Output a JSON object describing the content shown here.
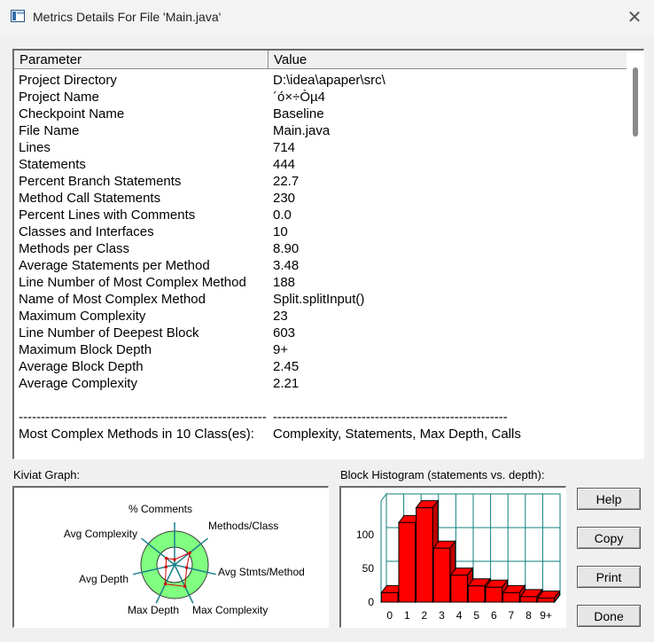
{
  "window": {
    "title": "Metrics Details For File 'Main.java'"
  },
  "table": {
    "headers": {
      "parameter": "Parameter",
      "value": "Value"
    },
    "rows": [
      {
        "p": "Project Directory",
        "v": "D:\\idea\\apaper\\src\\"
      },
      {
        "p": "Project Name",
        "v": "´ó×÷Òµ4"
      },
      {
        "p": "Checkpoint Name",
        "v": "Baseline"
      },
      {
        "p": "File Name",
        "v": "Main.java"
      },
      {
        "p": "Lines",
        "v": "714"
      },
      {
        "p": "Statements",
        "v": "444"
      },
      {
        "p": "Percent Branch Statements",
        "v": "22.7"
      },
      {
        "p": "Method Call Statements",
        "v": "230"
      },
      {
        "p": "Percent Lines with Comments",
        "v": "0.0"
      },
      {
        "p": "Classes and Interfaces",
        "v": "10"
      },
      {
        "p": "Methods per Class",
        "v": "8.90"
      },
      {
        "p": "Average Statements per Method",
        "v": "3.48"
      },
      {
        "p": "Line Number of Most Complex Method",
        "v": "188"
      },
      {
        "p": "Name of Most Complex Method",
        "v": "Split.splitInput()"
      },
      {
        "p": "Maximum Complexity",
        "v": "23"
      },
      {
        "p": "Line Number of Deepest Block",
        "v": "603"
      },
      {
        "p": "Maximum Block Depth",
        "v": "9+"
      },
      {
        "p": "Average Block Depth",
        "v": "2.45"
      },
      {
        "p": "Average Complexity",
        "v": "2.21"
      }
    ],
    "separator": {
      "p": "--------------------------------------------------------",
      "v": "-----------------------------------------------------"
    },
    "footer_row": {
      "p": "Most Complex Methods in 10 Class(es):",
      "v": "Complexity, Statements, Max Depth, Calls"
    }
  },
  "kiviat": {
    "label": "Kiviat Graph:",
    "axes": [
      "% Comments",
      "Methods/Class",
      "Avg Stmts/Method",
      "Max Complexity",
      "Max Depth",
      "Avg Depth",
      "Avg Complexity"
    ],
    "colors": {
      "outer": "#80ff80",
      "inner": "#ffffff",
      "spoke": "#1a7f8a",
      "poly": "#d40000"
    }
  },
  "histogram": {
    "label": "Block Histogram (statements vs. depth):",
    "chart_data": {
      "type": "bar",
      "categories": [
        "0",
        "1",
        "2",
        "3",
        "4",
        "5",
        "6",
        "7",
        "8",
        "9+"
      ],
      "values": [
        14,
        118,
        140,
        80,
        40,
        24,
        22,
        14,
        8,
        6
      ],
      "ylim": [
        0,
        150
      ],
      "yticks": [
        0,
        50,
        100
      ],
      "bar_color": "#ff0000",
      "grid_color": "#0f7f7f"
    }
  },
  "buttons": {
    "help": "Help",
    "copy": "Copy",
    "print": "Print",
    "done": "Done"
  }
}
